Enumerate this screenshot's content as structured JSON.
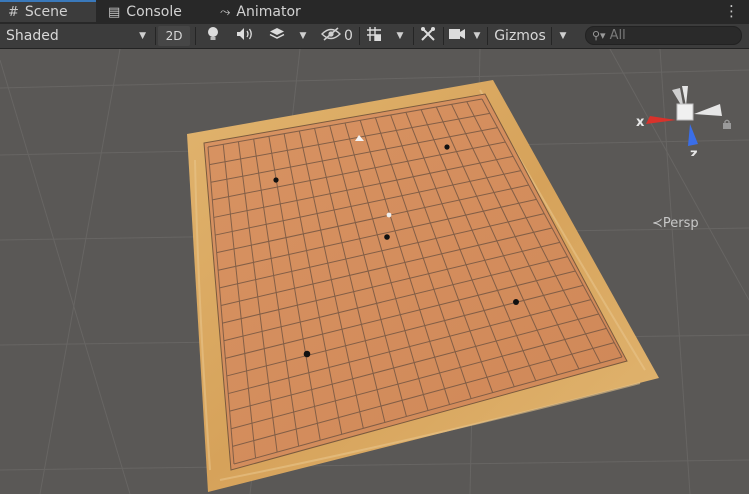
{
  "tabs": [
    {
      "label": "Scene",
      "icon": "grid-icon",
      "active": true
    },
    {
      "label": "Console",
      "icon": "console-icon",
      "active": false
    },
    {
      "label": "Animator",
      "icon": "animator-icon",
      "active": false
    }
  ],
  "toolbar": {
    "shading_mode": "Shaded",
    "mode_2d": "2D",
    "hidden_count": "0",
    "gizmos_label": "Gizmos",
    "search_placeholder": "All"
  },
  "gizmo": {
    "x_label": "x",
    "z_label": "z",
    "projection_label": "Persp"
  },
  "colors": {
    "tab_active_accent": "#3a79bb",
    "axis_x": "#d9322b",
    "axis_z": "#3a6ee8"
  }
}
